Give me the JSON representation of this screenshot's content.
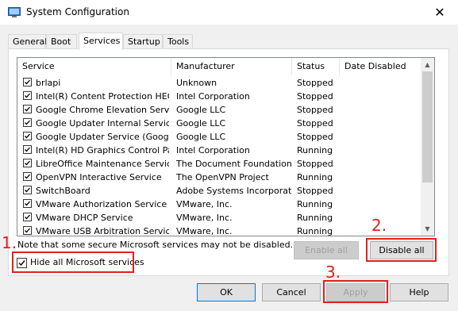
{
  "window": {
    "title": "System Configuration",
    "close_glyph": "✕"
  },
  "tabs": [
    "General",
    "Boot",
    "Services",
    "Startup",
    "Tools"
  ],
  "columns": [
    "Service",
    "Manufacturer",
    "Status",
    "Date Disabled"
  ],
  "rows": [
    {
      "service": "brlapi",
      "manufacturer": "Unknown",
      "status": "Stopped"
    },
    {
      "service": "Intel(R) Content Protection HEC...",
      "manufacturer": "Intel Corporation",
      "status": "Stopped"
    },
    {
      "service": "Google Chrome Elevation Service...",
      "manufacturer": "Google LLC",
      "status": "Stopped"
    },
    {
      "service": "Google Updater Internal Service...",
      "manufacturer": "Google LLC",
      "status": "Stopped"
    },
    {
      "service": "Google Updater Service (Google...",
      "manufacturer": "Google LLC",
      "status": "Stopped"
    },
    {
      "service": "Intel(R) HD Graphics Control Pa...",
      "manufacturer": "Intel Corporation",
      "status": "Running"
    },
    {
      "service": "LibreOffice Maintenance Service",
      "manufacturer": "The Document Foundation",
      "status": "Stopped"
    },
    {
      "service": "OpenVPN Interactive Service",
      "manufacturer": "The OpenVPN Project",
      "status": "Running"
    },
    {
      "service": "SwitchBoard",
      "manufacturer": "Adobe Systems Incorporated",
      "status": "Stopped"
    },
    {
      "service": "VMware Authorization Service",
      "manufacturer": "VMware, Inc.",
      "status": "Running"
    },
    {
      "service": "VMware DHCP Service",
      "manufacturer": "VMware, Inc.",
      "status": "Running"
    },
    {
      "service": "VMware USB Arbitration Service",
      "manufacturer": "VMware, Inc.",
      "status": "Running"
    }
  ],
  "note": "Note that some secure Microsoft services may not be disabled.",
  "buttons": {
    "enable_all": "Enable all",
    "disable_all": "Disable all",
    "ok": "OK",
    "cancel": "Cancel",
    "apply": "Apply",
    "help": "Help"
  },
  "hide_ms_label": "Hide all Microsoft services",
  "hide_ms_checked": true,
  "annotations": [
    "1.",
    "2.",
    "3."
  ],
  "colors": {
    "annotation": "#e02020",
    "default_button_border": "#0078d7"
  }
}
